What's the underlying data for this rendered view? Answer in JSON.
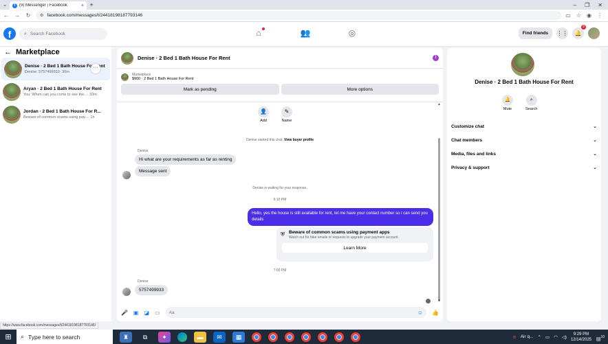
{
  "browser": {
    "tab_title": "(9) Messenger | Facebook",
    "url": "facebook.com/messages/t/24418198187793146",
    "status_url": "https://www.facebook.com/messages/t/24418198187793146/"
  },
  "header": {
    "search_placeholder": "Search Facebook",
    "find_friends": "Find friends",
    "notif_badge": "9"
  },
  "left": {
    "title": "Marketplace",
    "conversations": [
      {
        "name": "Denise · 2 Bed 1 Bath House For Rent",
        "preview": "Denise: 5757499933",
        "time": " · 30m"
      },
      {
        "name": "Aryan · 2 Bed 1 Bath House For Rent",
        "preview": "You: When can you come to see the...",
        "time": " · 33m"
      },
      {
        "name": "Jordan · 2 Bed 1 Bath House For R...",
        "preview": "Beware of common scams using pay...",
        "time": " · 1h"
      }
    ]
  },
  "chat": {
    "title": "Denise · 2 Bed 1 Bath House For Rent",
    "marketplace_label": "Marketplace",
    "listing": "$900 · 2 Bed 1 Bath House For Rent",
    "btn_pending": "Mark as pending",
    "btn_more": "More options",
    "action_add": "Add",
    "action_name": "Name",
    "started_text": "Denise started this chat. ",
    "view_profile": "View buyer profile",
    "sender1": "Denise",
    "msg1": "Hi what are your requirements as far as renting",
    "msg2": "Message sent",
    "waiting": "Denise is waiting for your response.",
    "time1": "6:10 PM",
    "msg_out": "Hello, yes the house is still available for rent, let me have your contact number so i can send you  details",
    "warn_title": "Beware of common scams using payment apps",
    "warn_desc": "Watch out for fake emails or requests to upgrade your payment account.",
    "learn_more": "Learn More",
    "time2": "7:00 PM",
    "sender2": "Denise",
    "msg3": "5757499933",
    "composer_placeholder": "Aa"
  },
  "right": {
    "title": "Denise · 2 Bed 1 Bath House For Rent",
    "mute": "Mute",
    "search": "Search",
    "menu": [
      "Customize chat",
      "Chat members",
      "Media, files and links",
      "Privacy & support"
    ]
  },
  "taskbar": {
    "search_text": "Type here to search",
    "weather": "Air q...",
    "time": "9:29 PM",
    "date": "12/14/2025",
    "notif_count": "10"
  },
  "colors": {
    "fb_blue": "#1877f2",
    "outgoing_bubble": "#4b2ee8",
    "badge_red": "#e41e3f"
  }
}
